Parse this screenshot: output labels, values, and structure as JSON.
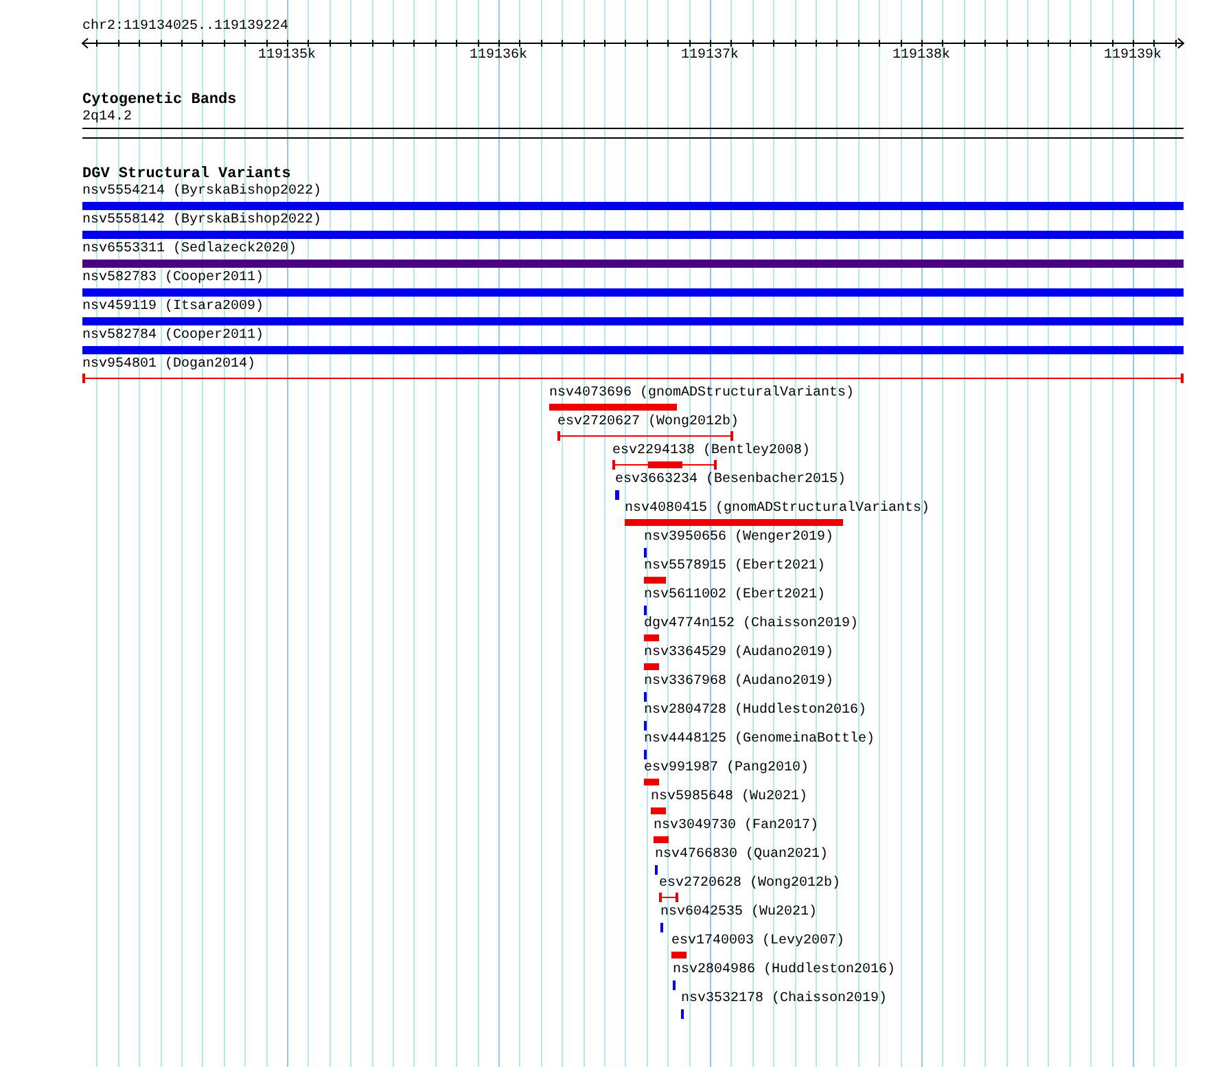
{
  "ruler": {
    "location": "chr2:119134025..119139224",
    "ticks": [
      "119135k",
      "119136k",
      "119137k",
      "119138k",
      "119139k"
    ]
  },
  "tracks": [
    {
      "title": "Cytogenetic Bands",
      "kind": "cytoband",
      "features": [
        {
          "label": "2q14.2"
        }
      ]
    },
    {
      "title": "DGV Structural Variants",
      "kind": "variants",
      "features": [
        {
          "label": "nsv5554214 (ByrskaBishop2022)",
          "kind": "bar",
          "color": "#0000ee"
        },
        {
          "label": "nsv5558142 (ByrskaBishop2022)",
          "kind": "bar",
          "color": "#0000ee"
        },
        {
          "label": "nsv6553311 (Sedlazeck2020)",
          "kind": "bar",
          "color": "#4b0082"
        },
        {
          "label": "nsv582783 (Cooper2011)",
          "kind": "bar",
          "color": "#0000ee"
        },
        {
          "label": "nsv459119 (Itsara2009)",
          "kind": "bar",
          "color": "#0000ee"
        },
        {
          "label": "nsv582784 (Cooper2011)",
          "kind": "bar",
          "color": "#0000ee"
        },
        {
          "label": "nsv954801 (Dogan2014)",
          "kind": "span",
          "color": "#ee0000"
        },
        {
          "label": "nsv4073696 (gnomADStructuralVariants)",
          "kind": "bar",
          "color": "#ee0000"
        },
        {
          "label": "esv2720627 (Wong2012b)",
          "kind": "span",
          "color": "#ee0000"
        },
        {
          "label": "esv2294138 (Bentley2008)",
          "kind": "span-block",
          "color": "#ee0000"
        },
        {
          "label": "esv3663234 (Besenbacher2015)",
          "kind": "bar",
          "color": "#0000ee"
        },
        {
          "label": "nsv4080415 (gnomADStructuralVariants)",
          "kind": "bar",
          "color": "#ee0000"
        },
        {
          "label": "nsv3950656 (Wenger2019)",
          "kind": "bar",
          "color": "#0000ee"
        },
        {
          "label": "nsv5578915 (Ebert2021)",
          "kind": "bar",
          "color": "#ee0000"
        },
        {
          "label": "nsv5611002 (Ebert2021)",
          "kind": "bar",
          "color": "#0000ee"
        },
        {
          "label": "dgv4774n152 (Chaisson2019)",
          "kind": "bar",
          "color": "#ee0000"
        },
        {
          "label": "nsv3364529 (Audano2019)",
          "kind": "bar",
          "color": "#ee0000"
        },
        {
          "label": "nsv3367968 (Audano2019)",
          "kind": "bar",
          "color": "#0000ee"
        },
        {
          "label": "nsv2804728 (Huddleston2016)",
          "kind": "bar",
          "color": "#0000ee"
        },
        {
          "label": "nsv4448125 (GenomeinaBottle)",
          "kind": "bar",
          "color": "#0000ee"
        },
        {
          "label": "esv991987 (Pang2010)",
          "kind": "bar",
          "color": "#ee0000"
        },
        {
          "label": "nsv5985648 (Wu2021)",
          "kind": "bar",
          "color": "#ee0000"
        },
        {
          "label": "nsv3049730 (Fan2017)",
          "kind": "bar",
          "color": "#ee0000"
        },
        {
          "label": "nsv4766830 (Quan2021)",
          "kind": "bar",
          "color": "#0000ee"
        },
        {
          "label": "esv2720628 (Wong2012b)",
          "kind": "span",
          "color": "#ee0000"
        },
        {
          "label": "nsv6042535 (Wu2021)",
          "kind": "bar",
          "color": "#0000ee"
        },
        {
          "label": "esv1740003 (Levy2007)",
          "kind": "bar",
          "color": "#ee0000"
        },
        {
          "label": "nsv2804986 (Huddleston2016)",
          "kind": "bar",
          "color": "#0000ee"
        },
        {
          "label": "nsv3532178 (Chaisson2019)",
          "kind": "bar",
          "color": "#0000ee"
        }
      ]
    }
  ]
}
